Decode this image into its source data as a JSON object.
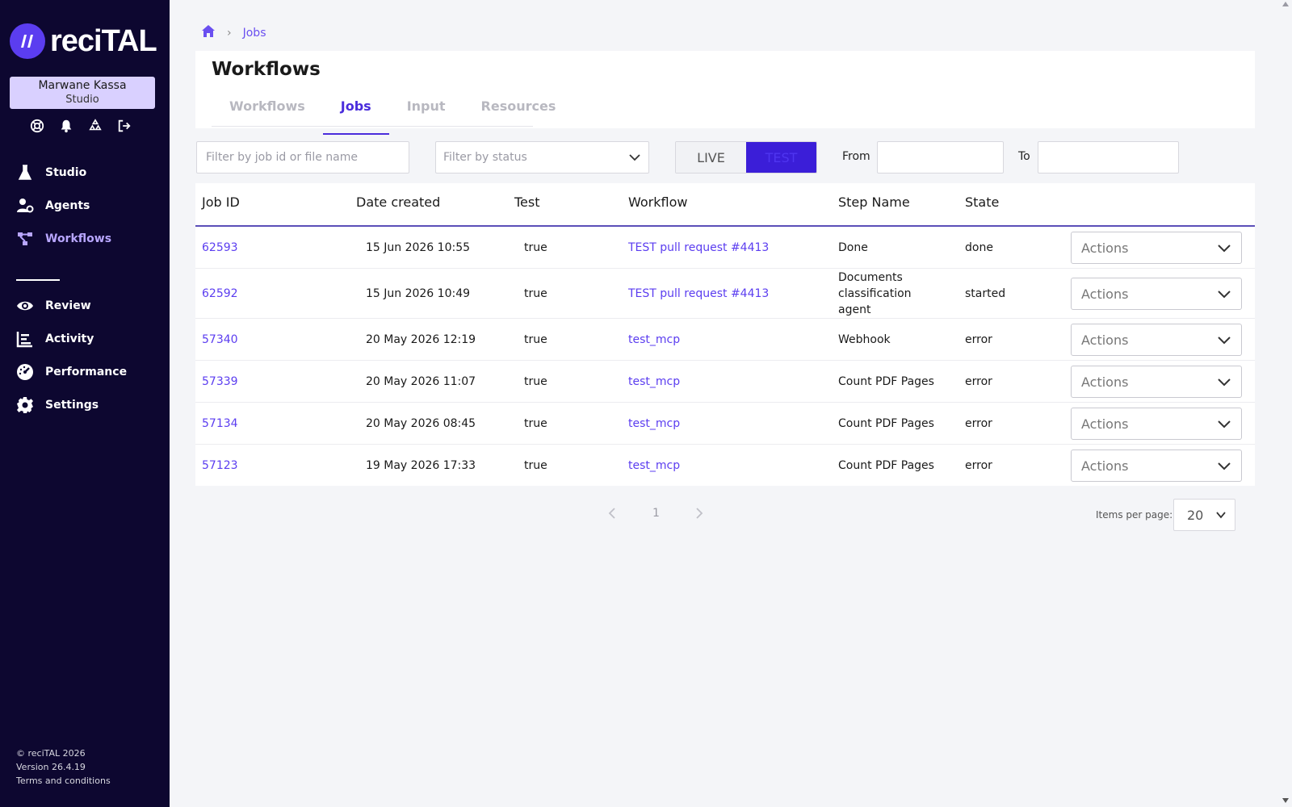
{
  "app": {
    "logo_text": "reciTAL",
    "logo_icon": "recital-logo-icon"
  },
  "user": {
    "name": "Marwane Kassa",
    "role": "Studio",
    "icons": [
      "support-icon",
      "bell-icon",
      "recycle-icon",
      "logout-icon"
    ]
  },
  "nav": {
    "primary": [
      {
        "label": "Studio",
        "icon": "flask-icon"
      },
      {
        "label": "Agents",
        "icon": "agents-icon"
      },
      {
        "label": "Workflows",
        "icon": "workflow-icon"
      }
    ],
    "secondary": [
      {
        "label": "Review",
        "icon": "eye-icon"
      },
      {
        "label": "Activity",
        "icon": "activity-icon"
      },
      {
        "label": "Performance",
        "icon": "gauge-icon"
      },
      {
        "label": "Settings",
        "icon": "gear-icon"
      }
    ]
  },
  "footer": {
    "copyright": "© reciTAL 2026",
    "version": "Version 26.4.19",
    "terms": "Terms and conditions"
  },
  "breadcrumb": {
    "current": "Jobs"
  },
  "page": {
    "title": "Workflows",
    "tabs": [
      "Workflows",
      "Jobs",
      "Input",
      "Resources"
    ],
    "active_tab": "Jobs"
  },
  "filters": {
    "search_placeholder": "Filter by job id or file name",
    "status_placeholder": "Filter by status",
    "mode_live": "LIVE",
    "mode_test": "TEST",
    "active_mode": "TEST",
    "from_label": "From",
    "to_label": "To"
  },
  "table": {
    "columns": [
      "Job ID",
      "Date created",
      "Test",
      "Workflow",
      "Step Name",
      "State"
    ],
    "actions_label": "Actions",
    "rows": [
      {
        "id": "62593",
        "date": "15 Jun 2026 10:55",
        "test": "true",
        "workflow": "TEST pull request #4413",
        "step": "Done",
        "state": "done"
      },
      {
        "id": "62592",
        "date": "15 Jun 2026 10:49",
        "test": "true",
        "workflow": "TEST pull request #4413",
        "step": "Documents classification agent",
        "state": "started"
      },
      {
        "id": "57340",
        "date": "20 May 2026 12:19",
        "test": "true",
        "workflow": "test_mcp",
        "step": "Webhook",
        "state": "error"
      },
      {
        "id": "57339",
        "date": "20 May 2026 11:07",
        "test": "true",
        "workflow": "test_mcp",
        "step": "Count PDF Pages",
        "state": "error"
      },
      {
        "id": "57134",
        "date": "20 May 2026 08:45",
        "test": "true",
        "workflow": "test_mcp",
        "step": "Count PDF Pages",
        "state": "error"
      },
      {
        "id": "57123",
        "date": "19 May 2026 17:33",
        "test": "true",
        "workflow": "test_mcp",
        "step": "Count PDF Pages",
        "state": "error"
      }
    ]
  },
  "pagination": {
    "current_page": "1",
    "items_per_page_label": "Items per page:",
    "items_per_page": "20"
  },
  "colors": {
    "sidebar_bg": "#0d0730",
    "accent": "#5b3df0",
    "active_tab": "#4a2ddc",
    "user_card": "#d9d0ff"
  }
}
